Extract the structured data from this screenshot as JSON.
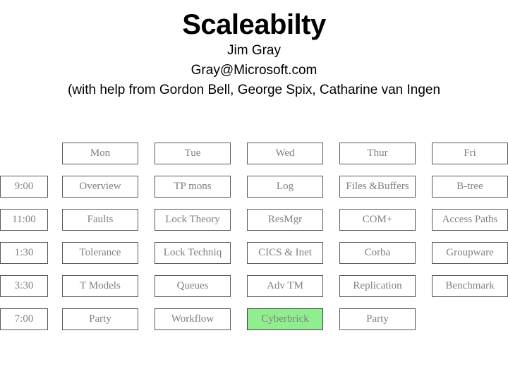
{
  "slide": {
    "title": "Scaleabilty",
    "subtitles": [
      "Jim Gray",
      "Gray@Microsoft.com",
      "(with help from Gordon Bell, George Spix, Catharine van Ingen"
    ]
  },
  "schedule": {
    "corner_label": "",
    "day_headers": [
      "Mon",
      "Tue",
      "Wed",
      "Thur",
      "Fri"
    ],
    "times": [
      "9:00",
      "11:00",
      "1:30",
      "3:30",
      "7:00"
    ],
    "rows": [
      {
        "time": "9:00",
        "cells": [
          "Overview",
          "TP mons",
          "Log",
          "Files &Buffers",
          "B-tree"
        ]
      },
      {
        "time": "11:00",
        "cells": [
          "Faults",
          "Lock Theory",
          "ResMgr",
          "COM+",
          "Access Paths"
        ]
      },
      {
        "time": "1:30",
        "cells": [
          "Tolerance",
          "Lock Techniq",
          "CICS & Inet",
          "Corba",
          "Groupware"
        ]
      },
      {
        "time": "3:30",
        "cells": [
          "T Models",
          "Queues",
          "Adv TM",
          "Replication",
          "Benchmark"
        ]
      },
      {
        "time": "7:00",
        "cells": [
          "Party",
          "Workflow",
          "Cyberbrick",
          "Party",
          ""
        ]
      }
    ],
    "highlight": {
      "row": 4,
      "col": 2,
      "label": "Cyberbrick",
      "color": "#90ee90"
    },
    "empty_cells": [
      {
        "row": 4,
        "col": 4
      }
    ],
    "colors": {
      "cell_text": "#808080",
      "cell_border": "#595959",
      "cell_background": "#ffffff",
      "highlight_background": "#90ee90",
      "title_text": "#000000"
    }
  }
}
